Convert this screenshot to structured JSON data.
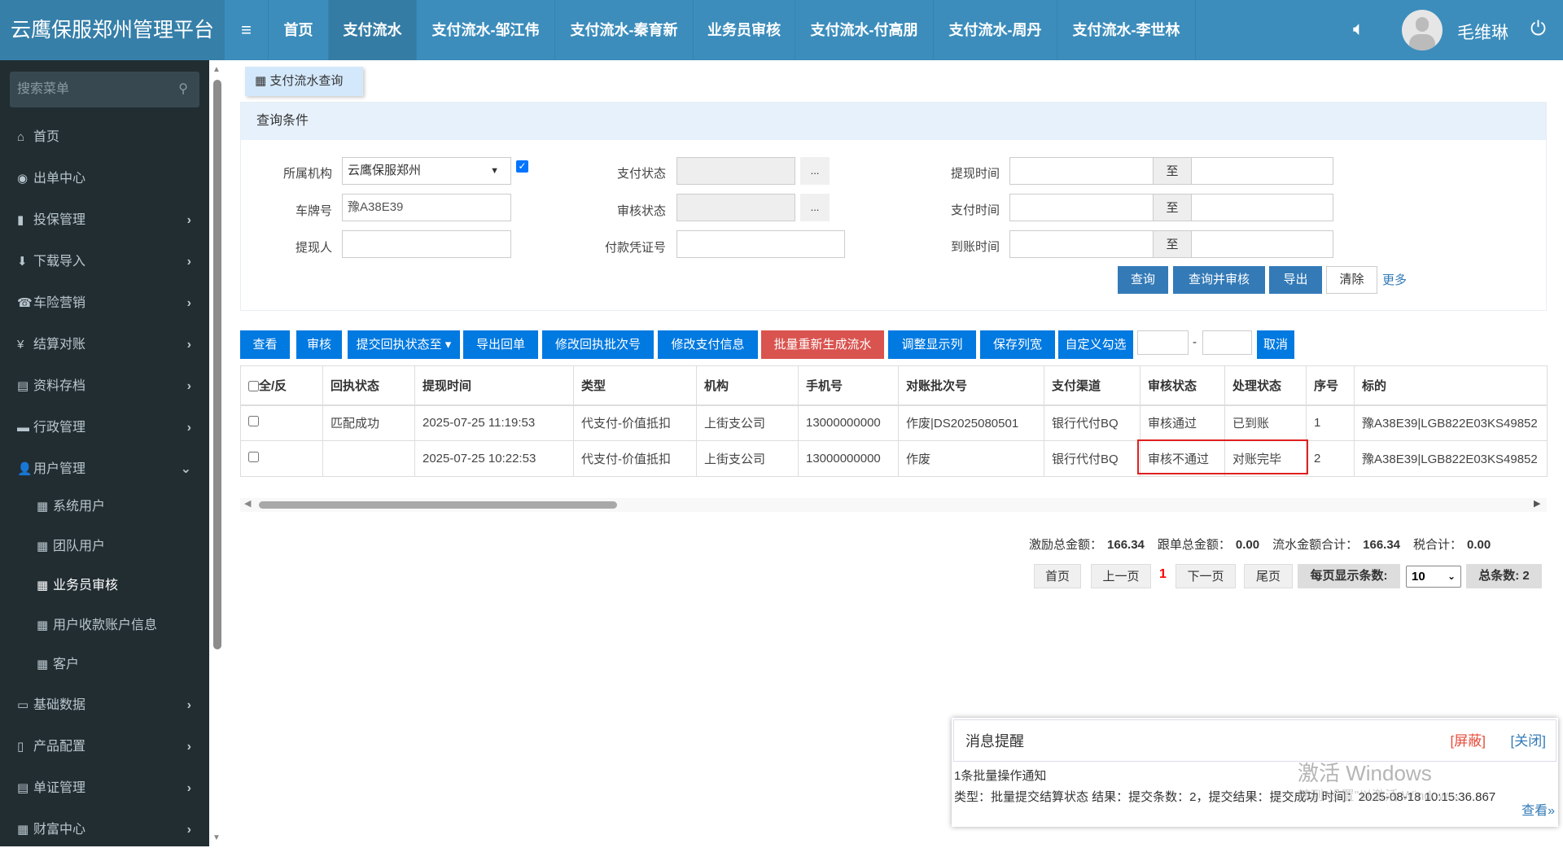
{
  "app": {
    "title": "云鹰保服郑州管理平台",
    "user": "毛维琳"
  },
  "nav": {
    "tabs": [
      "首页",
      "支付流水",
      "支付流水-邹江伟",
      "支付流水-秦育新",
      "业务员审核",
      "支付流水-付高朋",
      "支付流水-周丹",
      "支付流水-李世林"
    ],
    "active": 1
  },
  "sidebar": {
    "search_placeholder": "搜索菜单",
    "items": [
      {
        "label": "首页",
        "icon": "⌂",
        "chev": ""
      },
      {
        "label": "出单中心",
        "icon": "◉",
        "chev": ""
      },
      {
        "label": "投保管理",
        "icon": "▮",
        "chev": "›"
      },
      {
        "label": "下载导入",
        "icon": "⬇",
        "chev": "›"
      },
      {
        "label": "车险营销",
        "icon": "☎",
        "chev": "›"
      },
      {
        "label": "结算对账",
        "icon": "¥",
        "chev": "›"
      },
      {
        "label": "资料存档",
        "icon": "▤",
        "chev": "›"
      },
      {
        "label": "行政管理",
        "icon": "▬",
        "chev": "›"
      },
      {
        "label": "用户管理",
        "icon": "👤",
        "chev": "⌄"
      }
    ],
    "subitems": [
      "系统用户",
      "团队用户",
      "业务员审核",
      "用户收款账户信息",
      "客户"
    ],
    "current_sub": 2,
    "items2": [
      {
        "label": "基础数据",
        "icon": "▭",
        "chev": "›"
      },
      {
        "label": "产品配置",
        "icon": "▯",
        "chev": "›"
      },
      {
        "label": "单证管理",
        "icon": "▤",
        "chev": "›"
      },
      {
        "label": "财富中心",
        "icon": "▦",
        "chev": "›"
      }
    ]
  },
  "page_tab": "支付流水查询",
  "query": {
    "title": "查询条件",
    "org_label": "所属机构",
    "org_value": "云鹰保服郑州",
    "plate_label": "车牌号",
    "plate_value": "豫A38E39",
    "withdrawer_label": "提现人",
    "pay_status_label": "支付状态",
    "audit_status_label": "审核状态",
    "voucher_label": "付款凭证号",
    "ellipsis": "...",
    "withdraw_time_label": "提现时间",
    "pay_time_label": "支付时间",
    "arrive_time_label": "到账时间",
    "to": "至",
    "buttons": {
      "query": "查询",
      "query_audit": "查询并审核",
      "export": "导出",
      "clear": "清除",
      "more": "更多"
    }
  },
  "toolbar": [
    "查看",
    "审核",
    "提交回执状态至 ▾",
    "导出回单",
    "修改回执批次号",
    "修改支付信息",
    "批量重新生成流水",
    "调整显示列",
    "保存列宽",
    "自定义勾选"
  ],
  "toolbar_sep": "-",
  "toolbar_cancel": "取消",
  "table": {
    "columns": [
      "全/反",
      "回执状态",
      "提现时间",
      "类型",
      "机构",
      "手机号",
      "对账批次号",
      "支付渠道",
      "审核状态",
      "处理状态",
      "序号",
      "标的"
    ],
    "rows": [
      [
        "",
        "匹配成功",
        "2025-07-25 11:19:53",
        "代支付-价值抵扣",
        "上街支公司",
        "13000000000",
        "作废|DS2025080501",
        "银行代付BQ",
        "审核通过",
        "已到账",
        "1",
        "豫A38E39|LGB822E03KS49852"
      ],
      [
        "",
        "",
        "2025-07-25 10:22:53",
        "代支付-价值抵扣",
        "上街支公司",
        "13000000000",
        "作废",
        "银行代付BQ",
        "审核不通过",
        "对账完毕",
        "2",
        "豫A38E39|LGB822E03KS49852"
      ]
    ]
  },
  "totals": {
    "incentive_label": "激励总金额：",
    "incentive": "166.34",
    "follow_label": "跟单总金额：",
    "follow": "0.00",
    "flow_label": "流水金额合计：",
    "flow": "166.34",
    "tax_label": "税合计：",
    "tax": "0.00"
  },
  "pagination": {
    "first": "首页",
    "prev": "上一页",
    "current": "1",
    "next": "下一页",
    "last": "尾页",
    "per_page_label": "每页显示条数:",
    "per_page": "10",
    "total": "总条数: 2"
  },
  "notice": {
    "title": "消息提醒",
    "block": "[屏蔽]",
    "close": "[关闭]",
    "line1": "1条批量操作通知",
    "line2": "类型：批量提交结算状态  结果：提交条数：2，提交结果：提交成功  时间：2025-08-18 10:15:36.867",
    "view": "查看»"
  },
  "watermark": {
    "line1": "激活 Windows",
    "line2": "转到\"设置\"以激活 Windows。"
  }
}
